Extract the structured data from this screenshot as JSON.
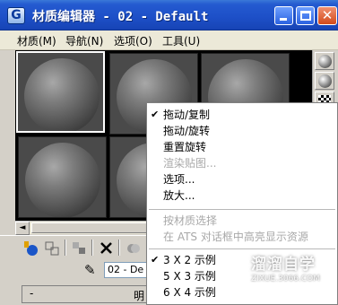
{
  "window": {
    "title": "材质编辑器 - 02 - Default",
    "app_icon_glyph": "G"
  },
  "menubar": {
    "items": [
      "材质(M)",
      "导航(N)",
      "选项(O)",
      "工具(U)"
    ]
  },
  "material_name": "02 - De",
  "rollout": {
    "minus": "-",
    "label": "明"
  },
  "context_menu": {
    "items": [
      {
        "label": "拖动/复制",
        "checked": true,
        "enabled": true
      },
      {
        "label": "拖动/旋转",
        "checked": false,
        "enabled": true
      },
      {
        "label": "重置旋转",
        "checked": false,
        "enabled": true
      },
      {
        "label": "渲染贴图...",
        "checked": false,
        "enabled": false
      },
      {
        "label": "选项...",
        "checked": false,
        "enabled": true
      },
      {
        "label": "放大...",
        "checked": false,
        "enabled": true
      },
      {
        "label": "按材质选择",
        "checked": false,
        "enabled": false
      },
      {
        "label": "在 ATS 对话框中高亮显示资源",
        "checked": false,
        "enabled": false
      },
      {
        "label": "3 X 2 示例",
        "checked": true,
        "enabled": true
      },
      {
        "label": "5 X 3 示例",
        "checked": false,
        "enabled": true
      },
      {
        "label": "6 X 4 示例",
        "checked": false,
        "enabled": true
      }
    ],
    "check_glyph": "✔"
  },
  "watermark": {
    "brand": "溜溜自学",
    "url": "ZIXUE.3066.COM"
  },
  "icons": {
    "title_min": "minimize-icon",
    "title_max": "maximize-icon",
    "title_close": "close-icon",
    "scroll_left": "◄",
    "close_glyph": "✕",
    "picker": "✎"
  },
  "colors": {
    "titlebar": "#245ad0",
    "window_bg": "#d4d0c8",
    "slot_bg": "#4a4a4a"
  }
}
